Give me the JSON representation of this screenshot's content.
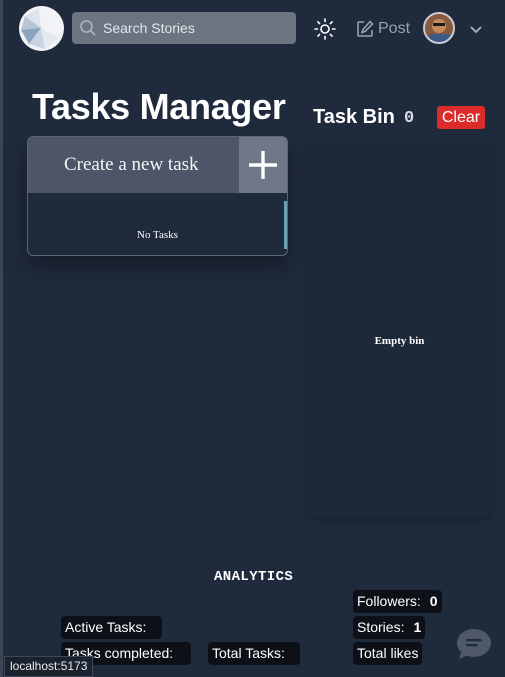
{
  "header": {
    "search_placeholder": "Search Stories",
    "post_label": "Post"
  },
  "tasks": {
    "title": "Tasks Manager",
    "create_label": "Create a new task",
    "empty_text": "No Tasks"
  },
  "bin": {
    "title": "Task Bin",
    "count": "0",
    "clear_label": "Clear",
    "empty_text": "Empty bin"
  },
  "analytics": {
    "title": "ANALYTICS",
    "followers_label": "Followers:",
    "followers_value": "0",
    "stories_label": "Stories:",
    "stories_value": "1",
    "active_label": "Active Tasks:",
    "completed_label": "Tasks completed:",
    "total_tasks_label": "Total Tasks:",
    "total_likes_label": "Total likes"
  },
  "status_bar": {
    "url": "localhost:5173"
  },
  "colors": {
    "background": "#1f2a3d",
    "clear_button": "#dc2b2b",
    "stat_badge": "#0d1117"
  },
  "icons": [
    "logo-icon",
    "search-icon",
    "sun-icon",
    "edit-icon",
    "avatar",
    "chevron-down-icon",
    "plus-icon",
    "chat-icon"
  ]
}
